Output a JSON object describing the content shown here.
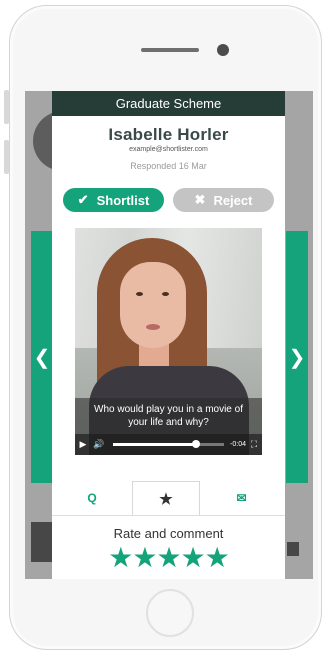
{
  "card": {
    "header_title": "Graduate Scheme",
    "candidate_name": "Isabelle Horler",
    "candidate_email": "example@shortlister.com",
    "responded_text": "Responded 16 Mar"
  },
  "actions": {
    "shortlist_label": "Shortlist",
    "reject_label": "Reject",
    "shortlist_icon": "✔",
    "reject_icon": "✖"
  },
  "nav": {
    "prev_icon": "❮",
    "next_icon": "❯"
  },
  "video": {
    "question_line1": "Who would play you in a movie of",
    "question_line2": "your life and why?",
    "time_remaining": "-0:04",
    "progress": 0.75,
    "play_icon": "▶",
    "volume_icon": "🔊",
    "fullscreen_icon": "⛶"
  },
  "tabs": [
    {
      "label": "Q",
      "name": "questions"
    },
    {
      "label": "★",
      "name": "rate"
    },
    {
      "label": "✉",
      "name": "message"
    }
  ],
  "rating": {
    "title": "Rate and comment",
    "stars": "★★★★★",
    "star_count": 5
  },
  "colors": {
    "accent": "#14a37a",
    "header": "#263c36",
    "reject": "#c4c4c4"
  }
}
